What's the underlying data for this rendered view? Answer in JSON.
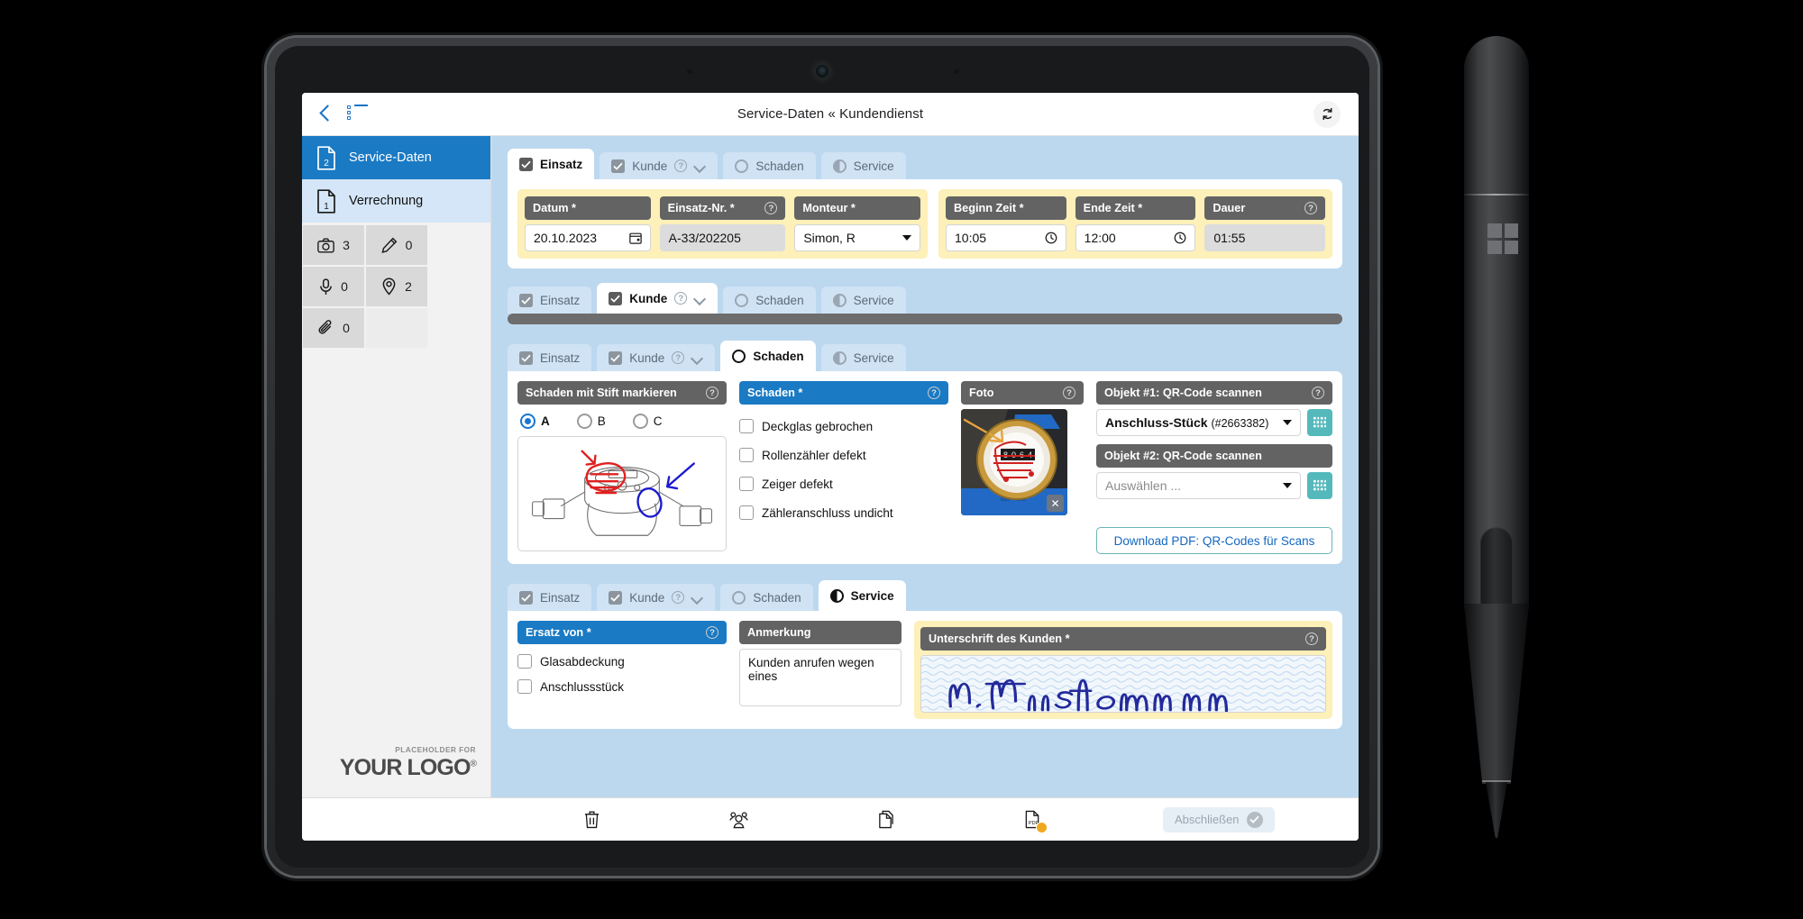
{
  "header": {
    "title": "Service-Daten « Kundendienst",
    "back_icon": "back-chevron-icon",
    "list_icon": "list-menu-icon",
    "refresh_icon": "refresh-icon"
  },
  "sidebar": {
    "items": [
      {
        "label": "Service-Daten",
        "badge": "2",
        "active": true
      },
      {
        "label": "Verrechnung",
        "badge": "1",
        "active": false
      }
    ],
    "counters": [
      {
        "icon": "camera-icon",
        "value": "3"
      },
      {
        "icon": "pencil-icon",
        "value": "0"
      },
      {
        "icon": "microphone-icon",
        "value": "0"
      },
      {
        "icon": "location-pin-icon",
        "value": "2"
      },
      {
        "icon": "paperclip-icon",
        "value": "0"
      }
    ],
    "logo": {
      "placeholder": "PLACEHOLDER FOR",
      "name": "YOUR LOGO",
      "mark": "®"
    }
  },
  "tabs": [
    "Einsatz",
    "Kunde",
    "Schaden",
    "Service"
  ],
  "sections": {
    "einsatz": {
      "active_tab": "Einsatz",
      "fields": [
        {
          "label": "Datum",
          "required": true,
          "value": "20.10.2023",
          "icon": "calendar-icon",
          "readonly": false
        },
        {
          "label": "Einsatz-Nr.",
          "required": true,
          "value": "A-33/202205",
          "help": true,
          "readonly": true
        },
        {
          "label": "Monteur",
          "required": true,
          "value": "Simon, R",
          "icon": "dropdown-caret-icon",
          "readonly": false
        }
      ],
      "time_fields": [
        {
          "label": "Beginn Zeit",
          "required": true,
          "value": "10:05",
          "icon": "clock-icon",
          "readonly": false
        },
        {
          "label": "Ende Zeit",
          "required": true,
          "value": "12:00",
          "icon": "clock-icon",
          "readonly": false
        },
        {
          "label": "Dauer",
          "required": false,
          "value": "01:55",
          "help": true,
          "readonly": true
        }
      ]
    },
    "kunde": {
      "active_tab": "Kunde",
      "collapsed": true
    },
    "schaden": {
      "active_tab": "Schaden",
      "marker_label": "Schaden mit Stift markieren",
      "marker_options": [
        "A",
        "B",
        "C"
      ],
      "marker_selected": "A",
      "damage_label": "Schaden",
      "damage_required": true,
      "damage_items": [
        "Deckglas gebrochen",
        "Rollenzähler defekt",
        "Zeiger defekt",
        "Zähleranschluss undicht"
      ],
      "photo_label": "Foto",
      "photo_remove": "✕",
      "objects": [
        {
          "label": "Objekt #1: QR-Code scannen",
          "value": "Anschluss-Stück",
          "value_sub": "(#2663382)",
          "help": true
        },
        {
          "label": "Objekt #2: QR-Code scannen",
          "value": "Auswählen ...",
          "placeholder": true,
          "help": false
        }
      ],
      "download_button": "Download PDF: QR-Codes für Scans"
    },
    "service": {
      "active_tab": "Service",
      "ersatz_label": "Ersatz von",
      "ersatz_required": true,
      "ersatz_items": [
        "Glasabdeckung",
        "Anschlussstück"
      ],
      "anmerkung_label": "Anmerkung",
      "anmerkung_value": "Kunden anrufen wegen eines",
      "signature_label": "Unterschrift des Kunden",
      "signature_required": true,
      "signature_name": "M. Mustermann"
    }
  },
  "bottombar": {
    "actions": [
      {
        "icon": "trash-icon",
        "name": "delete-button"
      },
      {
        "icon": "people-icon",
        "name": "contacts-button"
      },
      {
        "icon": "copy-icon",
        "name": "duplicate-button"
      },
      {
        "icon": "pdf-icon",
        "name": "export-pdf-button"
      }
    ],
    "finish_label": "Abschließen",
    "finish_icon": "check-circle-icon"
  },
  "colors": {
    "accent_blue": "#1a7ac4",
    "content_bg": "#bcd8ef",
    "card_yellow": "#fdf0b8",
    "label_gray": "#636363",
    "teal": "#55b9bb"
  }
}
